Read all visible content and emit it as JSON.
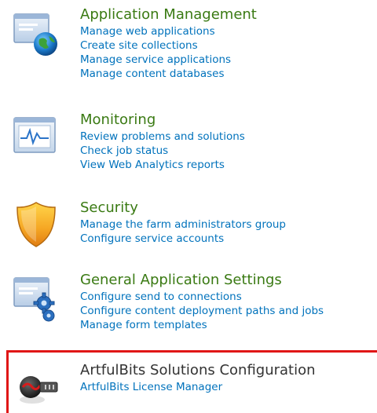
{
  "sections": [
    {
      "title": "Application Management",
      "icon": "application-management-icon",
      "links": [
        "Manage web applications",
        "Create site collections",
        "Manage service applications",
        "Manage content databases"
      ]
    },
    {
      "title": "Monitoring",
      "icon": "monitoring-icon",
      "links": [
        "Review problems and solutions",
        "Check job status",
        "View Web Analytics reports"
      ]
    },
    {
      "title": "Security",
      "icon": "security-shield-icon",
      "links": [
        "Manage the farm administrators group",
        "Configure service accounts"
      ]
    },
    {
      "title": "General Application Settings",
      "icon": "general-settings-icon",
      "links": [
        "Configure send to connections",
        "Configure content deployment paths and jobs",
        "Manage form templates"
      ]
    },
    {
      "title": "ArtfulBits Solutions Configuration",
      "icon": "artfulbits-icon",
      "links": [
        "ArtfulBits License Manager"
      ]
    }
  ],
  "colors": {
    "title_green": "#3a7a13",
    "link_blue": "#0072bc",
    "highlight_red": "#e01616"
  }
}
